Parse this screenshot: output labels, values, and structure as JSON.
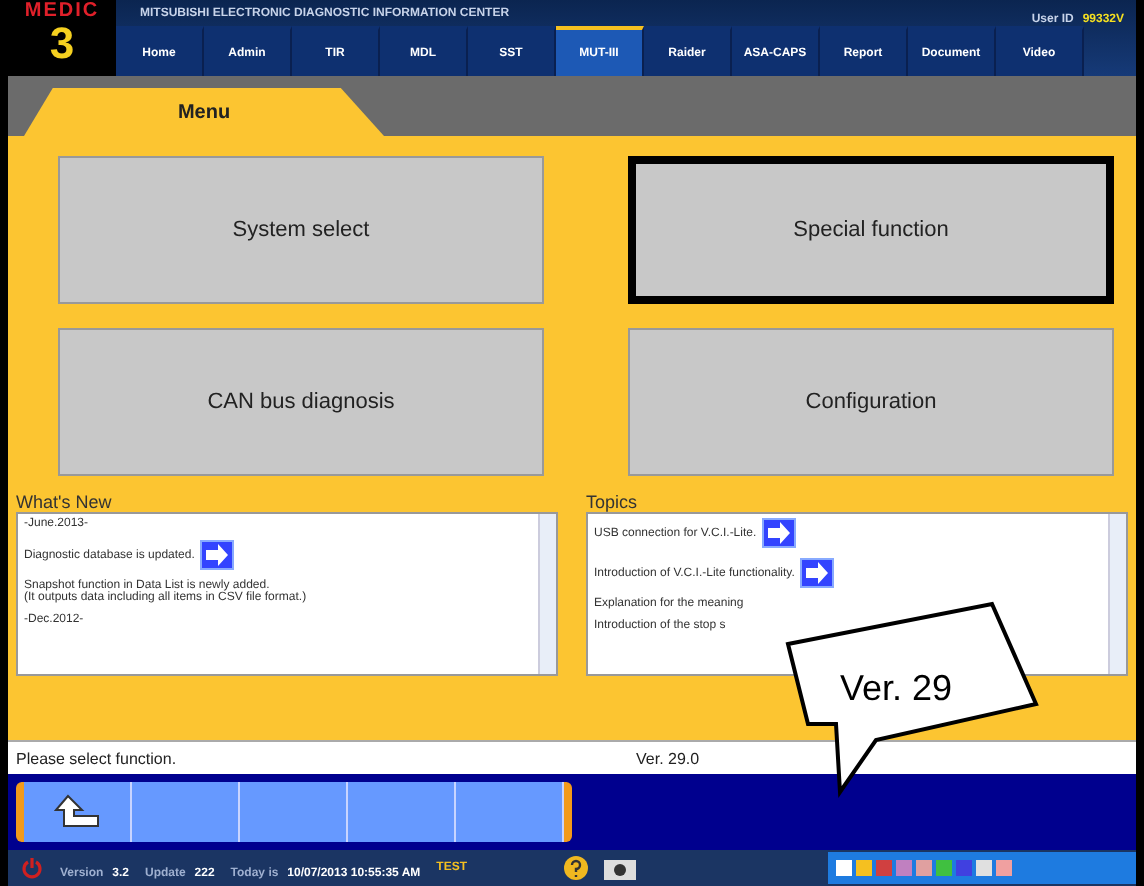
{
  "header": {
    "logo_top": "MEDIC",
    "logo_number": "3",
    "title": "MITSUBISHI ELECTRONIC DIAGNOSTIC INFORMATION CENTER",
    "user_label": "User ID",
    "user_id": "99332V"
  },
  "nav_tabs": [
    {
      "label": "Home",
      "selected": false
    },
    {
      "label": "Admin",
      "selected": false
    },
    {
      "label": "TIR",
      "selected": false
    },
    {
      "label": "MDL",
      "selected": false
    },
    {
      "label": "SST",
      "selected": false
    },
    {
      "label": "MUT-III",
      "selected": true
    },
    {
      "label": "Raider",
      "selected": false
    },
    {
      "label": "ASA-CAPS",
      "selected": false
    },
    {
      "label": "Report",
      "selected": false
    },
    {
      "label": "Document",
      "selected": false
    },
    {
      "label": "Video",
      "selected": false
    }
  ],
  "page_tab": "Menu",
  "menu_buttons": [
    {
      "label": "System select",
      "selected": false
    },
    {
      "label": "Special function",
      "selected": true
    },
    {
      "label": "CAN bus diagnosis",
      "selected": false
    },
    {
      "label": "Configuration",
      "selected": false
    }
  ],
  "whats_new": {
    "title": "What's New",
    "items": [
      {
        "kind": "date",
        "text": "-June.2013-"
      },
      {
        "kind": "link",
        "text": "Diagnostic database is updated."
      },
      {
        "kind": "note",
        "text": "Snapshot function in Data List is newly added.\n(It outputs data including all items in CSV file format.)"
      },
      {
        "kind": "date",
        "text": "-Dec.2012-"
      }
    ]
  },
  "topics": {
    "title": "Topics",
    "items": [
      {
        "kind": "link",
        "text": "USB connection for V.C.I.-Lite."
      },
      {
        "kind": "link",
        "text": "Introduction of V.C.I.-Lite functionality."
      },
      {
        "kind": "note",
        "text": "Explanation for the meaning"
      },
      {
        "kind": "note",
        "text": "Introduction of the stop s"
      }
    ]
  },
  "message": "Please select function.",
  "version": "Ver. 29.0",
  "callout": "Ver. 29",
  "status_bar": {
    "version_label": "Version",
    "version": "3.2",
    "update_label": "Update",
    "update": "222",
    "today_label": "Today is",
    "today": "10/07/2013 10:55:35 AM",
    "mode": "TEST"
  }
}
